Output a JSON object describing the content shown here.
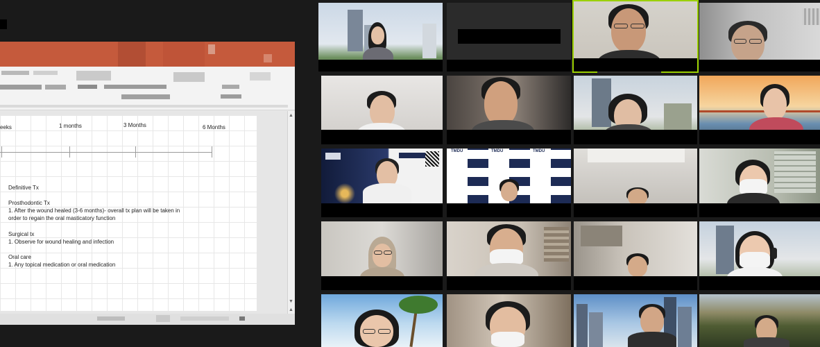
{
  "slide": {
    "timeline": {
      "labels": [
        "eeks",
        "1 months",
        "3 Months",
        "6 Months"
      ]
    },
    "heading": "Definitive Tx",
    "sections": [
      {
        "title": "Prosthodontic Tx",
        "lines": [
          "1.   After the wound healed (3-6 months)- overall tx plan will be taken in",
          "      order to regain the oral masticatory function"
        ]
      },
      {
        "title": "Surgical tx",
        "lines": [
          "1.   Observe for wound healing and infection"
        ]
      },
      {
        "title": "Oral care",
        "lines": [
          "1. Any topical medication or oral medication"
        ]
      }
    ]
  },
  "colors": {
    "ribbon": "#c55a3c",
    "active_speaker_border": "#9bd000",
    "background": "#1a1a1a"
  },
  "gallery": {
    "rows": 5,
    "columns": 4,
    "participants": 20,
    "active_speaker": "Row 1, column 3"
  },
  "participant_banner": {
    "logo_text": "TMDU"
  }
}
